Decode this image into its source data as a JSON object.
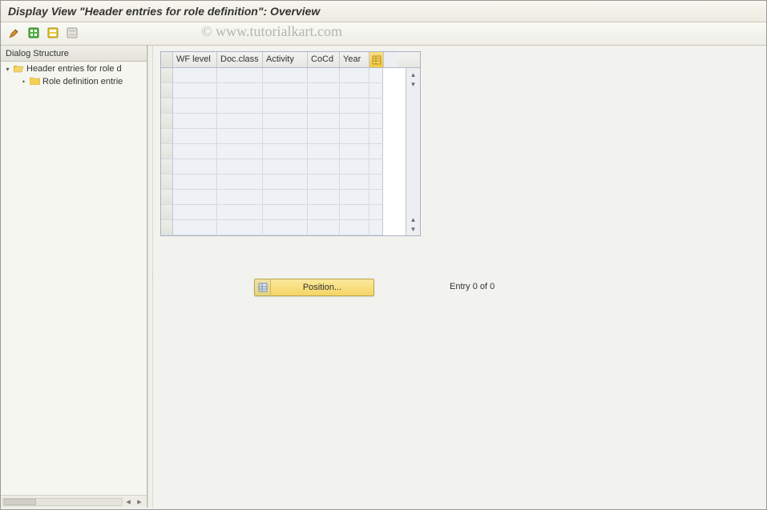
{
  "title": "Display View \"Header entries for role definition\": Overview",
  "watermark": "© www.tutorialkart.com",
  "toolbar_icons": {
    "i1": "change-display-icon",
    "i2": "select-all-icon",
    "i3": "select-block-icon",
    "i4": "deselect-icon"
  },
  "tree": {
    "header": "Dialog Structure",
    "items": [
      {
        "label": "Header entries for role d",
        "level": 0,
        "open": true
      },
      {
        "label": "Role definition entrie",
        "level": 1,
        "open": false
      }
    ]
  },
  "grid": {
    "columns": [
      "WF level",
      "Doc.class",
      "Activity",
      "CoCd",
      "Year"
    ],
    "row_count": 11,
    "settings_icon": "table-settings-icon"
  },
  "position_button": {
    "label": "Position...",
    "icon": "position-icon"
  },
  "entry_status": "Entry 0 of 0"
}
